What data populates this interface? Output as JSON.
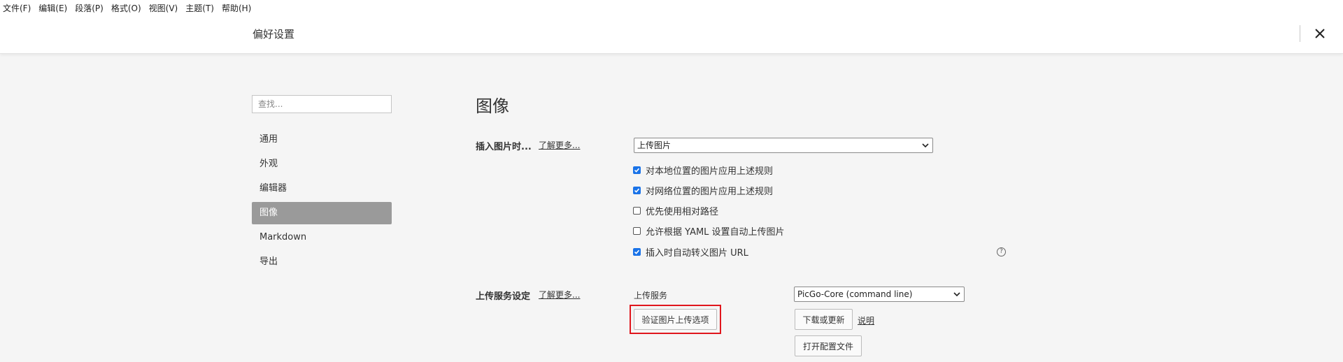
{
  "menu": [
    "文件(F)",
    "编辑(E)",
    "段落(P)",
    "格式(O)",
    "视图(V)",
    "主题(T)",
    "帮助(H)"
  ],
  "window": {
    "title": "偏好设置"
  },
  "sidebar": {
    "search_placeholder": "查找...",
    "items": [
      {
        "label": "通用",
        "active": false
      },
      {
        "label": "外观",
        "active": false
      },
      {
        "label": "编辑器",
        "active": false
      },
      {
        "label": "图像",
        "active": true
      },
      {
        "label": "Markdown",
        "active": false
      },
      {
        "label": "导出",
        "active": false
      }
    ]
  },
  "page": {
    "heading": "图像",
    "insert": {
      "label": "插入图片时...",
      "learn_more": "了解更多...",
      "select_value": "上传图片",
      "options": [
        {
          "label": "对本地位置的图片应用上述规则",
          "checked": true
        },
        {
          "label": "对网络位置的图片应用上述规则",
          "checked": true
        },
        {
          "label": "优先使用相对路径",
          "checked": false
        },
        {
          "label": "允许根据 YAML 设置自动上传图片",
          "checked": false
        },
        {
          "label": "插入时自动转义图片 URL",
          "checked": true
        }
      ],
      "help": "?"
    },
    "upload": {
      "label": "上传服务设定",
      "learn_more": "了解更多...",
      "service_label": "上传服务",
      "service_value": "PicGo-Core (command line)",
      "verify_button": "验证图片上传选项",
      "download_button": "下载或更新",
      "explain_link": "说明",
      "open_config_button": "打开配置文件"
    }
  },
  "colors": {
    "accent": "#1a73e8",
    "highlight": "#e0161d",
    "active_nav": "#9a9a9a"
  }
}
